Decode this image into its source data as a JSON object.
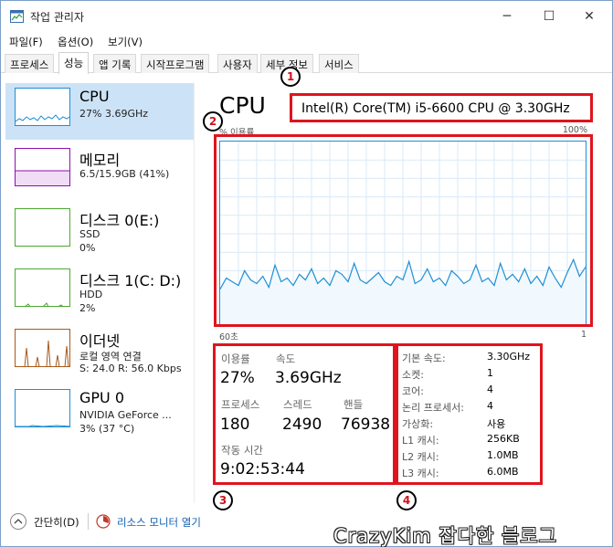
{
  "window": {
    "title": "작업 관리자",
    "minimize": "─",
    "maximize": "☐",
    "close": "✕"
  },
  "menu": [
    "파일(F)",
    "옵션(O)",
    "보기(V)"
  ],
  "tabs": [
    "프로세스",
    "성능",
    "앱 기록",
    "시작프로그램",
    "사용자",
    "세부 정보",
    "서비스"
  ],
  "active_tab": "성능",
  "sidebar": [
    {
      "name": "CPU",
      "lines": [
        "27% 3.69GHz"
      ],
      "color": "#1e8fd5"
    },
    {
      "name": "메모리",
      "lines": [
        "6.5/15.9GB (41%)"
      ],
      "color": "#8b12ae"
    },
    {
      "name": "디스크 0(E:)",
      "lines": [
        "SSD",
        "0%"
      ],
      "color": "#4ca833"
    },
    {
      "name": "디스크 1(C: D:)",
      "lines": [
        "HDD",
        "2%"
      ],
      "color": "#4ca833"
    },
    {
      "name": "이더넷",
      "lines": [
        "로컬 영역 연결",
        "S: 24.0  R: 56.0 Kbps"
      ],
      "color": "#a7591a"
    },
    {
      "name": "GPU 0",
      "lines": [
        "NVIDIA GeForce ...",
        "3% (37 °C)"
      ],
      "color": "#1e8fd5"
    }
  ],
  "main": {
    "title": "CPU",
    "model": "Intel(R) Core(TM) i5-6600 CPU @ 3.30GHz",
    "graph_label_left": "% 이용률",
    "graph_label_right": "100%",
    "graph_foot_left": "60초",
    "graph_foot_right": "1",
    "graph_color": "#1e8fd5",
    "cpu_history_percent": [
      20,
      26,
      24,
      22,
      30,
      25,
      23,
      27,
      21,
      33,
      24,
      26,
      22,
      28,
      25,
      31,
      23,
      26,
      22,
      30,
      28,
      24,
      34,
      25,
      23,
      26,
      29,
      24,
      22,
      27,
      25,
      35,
      23,
      25,
      31,
      24,
      26,
      22,
      30,
      27,
      23,
      25,
      33,
      24,
      26,
      22,
      34,
      25,
      28,
      24,
      31,
      23,
      27,
      22,
      32,
      26,
      21,
      29,
      36,
      27,
      32
    ]
  },
  "stats": {
    "util_label": "이용률",
    "util_value": "27%",
    "speed_label": "속도",
    "speed_value": "3.69GHz",
    "proc_label": "프로세스",
    "proc_value": "180",
    "thread_label": "스레드",
    "thread_value": "2490",
    "handle_label": "핸들",
    "handle_value": "76938",
    "uptime_label": "작동 시간",
    "uptime_value": "9:02:53:44"
  },
  "specs": [
    {
      "label": "기본 속도:",
      "value": "3.30GHz"
    },
    {
      "label": "소켓:",
      "value": "1"
    },
    {
      "label": "코어:",
      "value": "4"
    },
    {
      "label": "논리 프로세서:",
      "value": "4"
    },
    {
      "label": "가상화:",
      "value": "사용"
    },
    {
      "label": "L1 캐시:",
      "value": "256KB"
    },
    {
      "label": "L2 캐시:",
      "value": "1.0MB"
    },
    {
      "label": "L3 캐시:",
      "value": "6.0MB"
    }
  ],
  "annotations": [
    "1",
    "2",
    "3",
    "4"
  ],
  "bottom": {
    "fewer": "간단히(D)",
    "resmon": "리소스 모니터 열기"
  },
  "watermark": "CrazyKim 잡다한 블로그",
  "highlight_color": "#e0141e"
}
